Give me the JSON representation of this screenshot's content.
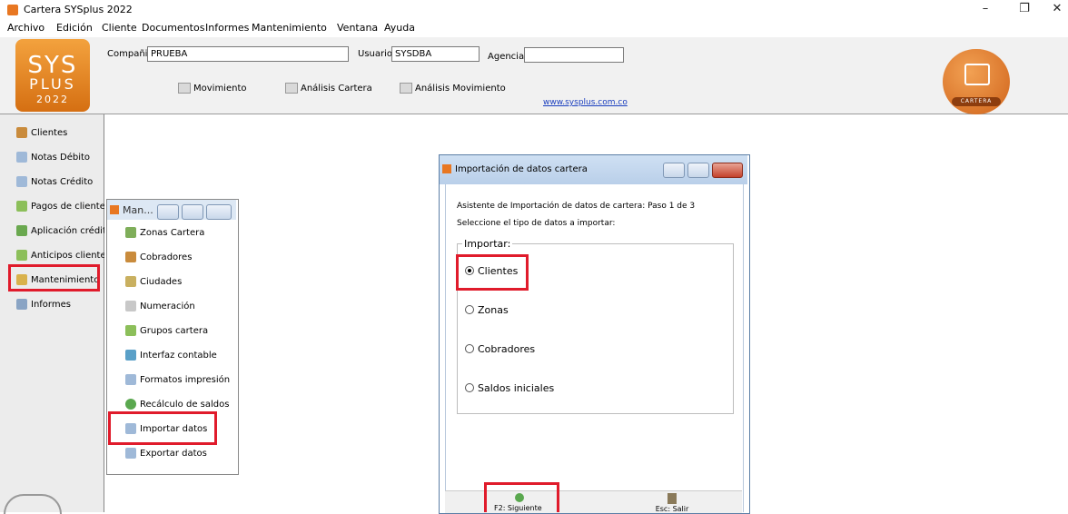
{
  "window": {
    "title": "Cartera SYSplus 2022",
    "controls": [
      "–",
      "❐",
      "✕"
    ]
  },
  "menu": [
    "Archivo",
    "Edición",
    "Cliente",
    "Documentos",
    "Informes",
    "Mantenimiento",
    "Ventana",
    "Ayuda"
  ],
  "header": {
    "logo": {
      "line1": "SYS",
      "line2": "PLUS",
      "line3": "2022"
    },
    "compania_label": "Compañia:",
    "compania_value": "PRUEBA",
    "usuario_label": "Usuario:",
    "usuario_value": "SYSDBA",
    "agencia_label": "Agencia",
    "agencia_value": "",
    "buttons": [
      "Movimiento",
      "Análisis Cartera",
      "Análisis Movimiento"
    ],
    "website": "www.sysplus.com.co",
    "cartera_logo_text": "CARTERA"
  },
  "sidebar": {
    "items": [
      "Clientes",
      "Notas Débito",
      "Notas Crédito",
      "Pagos de clientes",
      "Aplicación crédito",
      "Anticipos clientes",
      "Mantenimiento",
      "Informes"
    ],
    "highlighted": "Mantenimiento"
  },
  "mantenimiento_window": {
    "title": "Man...",
    "items": [
      "Zonas Cartera",
      "Cobradores",
      "Ciudades",
      "Numeración",
      "Grupos cartera",
      "Interfaz contable",
      "Formatos impresión",
      "Recálculo de saldos",
      "Importar datos",
      "Exportar datos"
    ],
    "highlighted": "Importar datos"
  },
  "dialog": {
    "title": "Importación de datos cartera",
    "step_text": "Asistente de Importación de datos de cartera: Paso 1 de 3",
    "instruction": "Seleccione el tipo de datos a importar:",
    "group_label": "Importar:",
    "options": [
      "Clientes",
      "Zonas",
      "Cobradores",
      "Saldos iniciales"
    ],
    "selected": "Clientes",
    "footer_buttons": [
      "F2: Siguiente",
      "Esc: Salir"
    ]
  },
  "colors": {
    "highlight": "#e01b2b",
    "brand_orange": "#e87722",
    "link": "#1a3ebf"
  }
}
